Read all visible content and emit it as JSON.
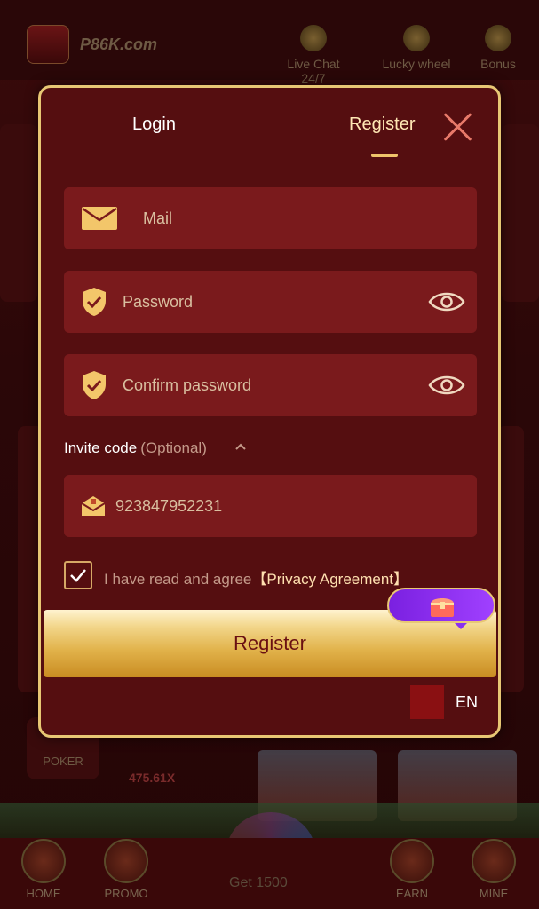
{
  "background": {
    "brand": "P86K.com",
    "logo_text": "P86K",
    "top_items": [
      "Live Chat 24/7",
      "Lucky wheel",
      "Bonus"
    ],
    "poker_label": "POKER",
    "multiplier": "475.61X",
    "get_text": "Get 1500",
    "nav": [
      "HOME",
      "PROMO",
      "EARN",
      "MINE"
    ]
  },
  "modal": {
    "tab_login": "Login",
    "tab_register": "Register",
    "mail_placeholder": "Mail",
    "password_placeholder": "Password",
    "confirm_placeholder": "Confirm password",
    "invite_label": "Invite code",
    "invite_optional": "(Optional)",
    "invite_value": "923847952231",
    "agree_text": "I have read and agree",
    "agree_link": "【Privacy Agreement】",
    "register_button": "Register",
    "language": "EN",
    "agree_checked": true
  },
  "colors": {
    "modal_bg": "#550e10",
    "field_bg": "#7a1a1c",
    "accent_gold": "#e8c774",
    "promo_purple": "#8a30f0"
  },
  "icons": [
    "mail-icon",
    "shield-check-icon",
    "eye-icon",
    "gift-envelope-icon",
    "close-icon",
    "chevron-up-icon",
    "checkbox-check-icon",
    "treasure-chest-icon"
  ]
}
